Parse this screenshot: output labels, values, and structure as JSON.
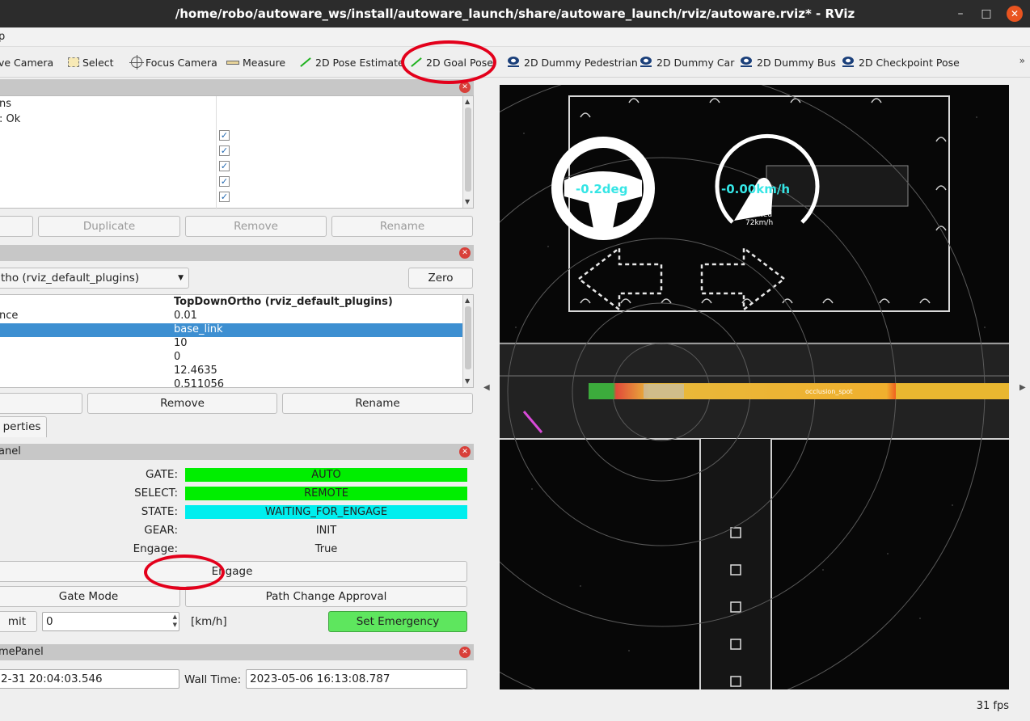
{
  "window": {
    "title": "/home/robo/autoware_ws/install/autoware_launch/share/autoware_launch/rviz/autoware.rviz* - RViz",
    "minimize_icon": "minimize-icon",
    "maximize_icon": "maximize-icon",
    "close_icon": "close-icon"
  },
  "menubar": {
    "partial_item": "p"
  },
  "toolbar": {
    "items": [
      {
        "label": "ve Camera"
      },
      {
        "label": "Select"
      },
      {
        "label": "Focus Camera"
      },
      {
        "label": "Measure"
      },
      {
        "label": "2D Pose Estimate"
      },
      {
        "label": "2D Goal Pose"
      },
      {
        "label": "2D Dummy Pedestrian"
      },
      {
        "label": "2D Dummy Car"
      },
      {
        "label": "2D Dummy Bus"
      },
      {
        "label": "2D Checkpoint Pose"
      }
    ],
    "more": "»",
    "autoware_icon_text": "Autoware"
  },
  "displays": {
    "lines": [
      "ns",
      ": Ok"
    ],
    "checks": [
      "✓",
      "✓",
      "✓",
      "✓",
      "✓"
    ],
    "buttons": {
      "add": "",
      "duplicate": "Duplicate",
      "remove": "Remove",
      "rename": "Rename"
    }
  },
  "views": {
    "view_type": "tho (rviz_default_plugins)",
    "zero": "Zero",
    "header_value": "TopDownOrtho (rviz_default_plugins)",
    "rows": [
      {
        "key": "nce",
        "value": "0.01"
      },
      {
        "key": "",
        "value": "base_link"
      },
      {
        "key": "",
        "value": "10"
      },
      {
        "key": "",
        "value": "0"
      },
      {
        "key": "",
        "value": "12.4635"
      },
      {
        "key": "",
        "value": "0.511056"
      }
    ],
    "buttons": {
      "left": "",
      "remove": "Remove",
      "rename": "Rename"
    },
    "tab": "perties"
  },
  "autoware_panel": {
    "title": "anel",
    "gate_label": "GATE:",
    "gate_value": "AUTO",
    "select_label": "SELECT:",
    "select_value": "REMOTE",
    "state_label": "STATE:",
    "state_value": "WAITING_FOR_ENGAGE",
    "gear_label": "GEAR:",
    "gear_value": "INIT",
    "engage_label": "Engage:",
    "engage_value": "True",
    "engage_button": "Engage",
    "gate_mode_button": "Gate Mode",
    "path_change_button": "Path Change Approval",
    "limit_label": "mit",
    "limit_value": "0",
    "unit": "[km/h]",
    "emergency_button": "Set Emergency"
  },
  "time_panel": {
    "title": "mePanel",
    "ros_time": "2-31 20:04:03.546",
    "wall_label": "Wall Time:",
    "wall_time": "2023-05-06 16:13:08.787"
  },
  "viewport": {
    "steering": "-0.2deg",
    "speed": "-0.00km/h",
    "limit_line1": "limited",
    "limit_line2": "72km/h",
    "occlusion": "occlusion_spot"
  },
  "status": {
    "fps": "31 fps"
  },
  "colors": {
    "annotation": "#e3001b",
    "selected_row": "#3d8fd1",
    "status_green": "#00ee00",
    "status_cyan": "#00eeee"
  }
}
